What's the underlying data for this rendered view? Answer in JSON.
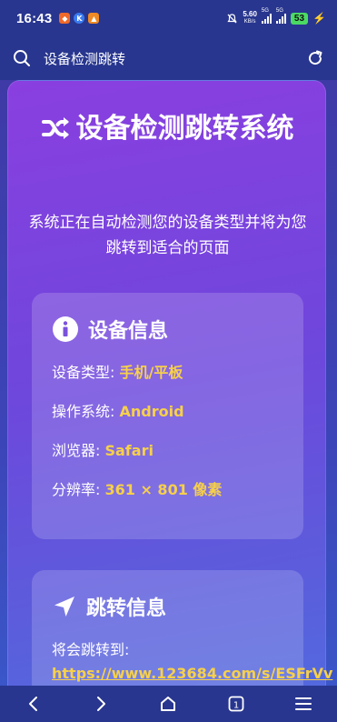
{
  "status_bar": {
    "time": "16:43",
    "net_speed": "5.60",
    "net_unit": "KB/s",
    "sig1_label": "5G",
    "sig2_label": "5G",
    "battery": "53"
  },
  "address_bar": {
    "text": "设备检测跳转"
  },
  "page": {
    "title": "设备检测跳转系统",
    "subtitle": "系统正在自动检测您的设备类型并将为您跳转到适合的页面",
    "device_card": {
      "heading": "设备信息",
      "rows": [
        {
          "label": "设备类型: ",
          "value": "手机/平板"
        },
        {
          "label": "操作系统: ",
          "value": "Android"
        },
        {
          "label": "浏览器: ",
          "value": "Safari"
        },
        {
          "label": "分辨率: ",
          "value": "361 × 801 像素"
        }
      ]
    },
    "redirect_card": {
      "heading": "跳转信息",
      "label": "将会跳转到:",
      "url": "https://www.123684.com/s/ESFrVv"
    }
  },
  "colors": {
    "accent_value": "#f7d04a",
    "bar_bg": "#28368f"
  },
  "icons": {
    "title": "shuffle-icon",
    "device": "info-circle-icon",
    "redirect": "location-arrow-icon"
  },
  "bottom_nav": {
    "tab_count": "1"
  }
}
